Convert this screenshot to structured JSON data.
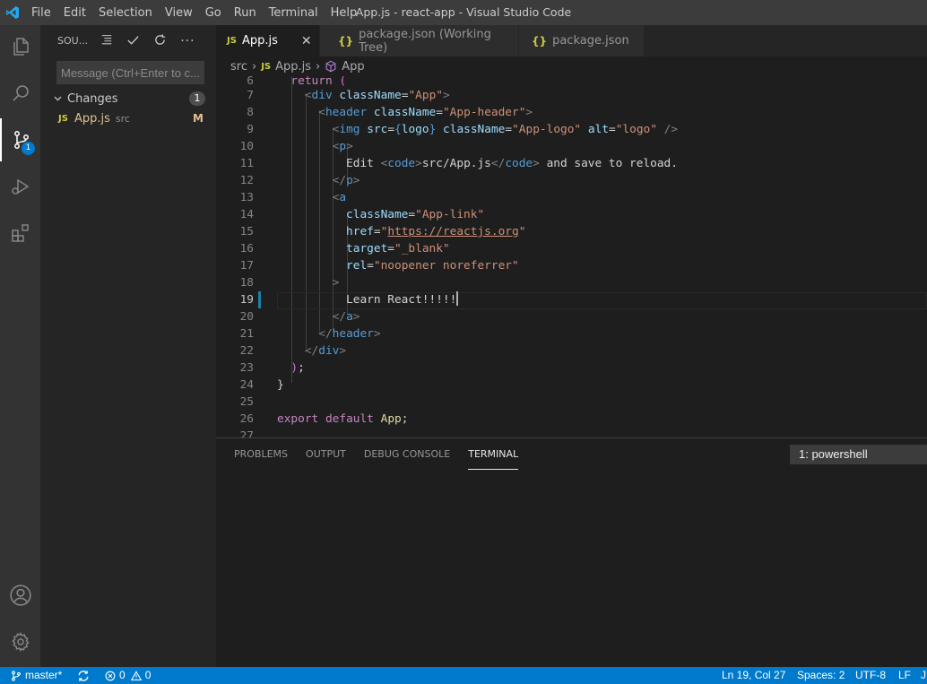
{
  "window": {
    "title": "App.js - react-app - Visual Studio Code"
  },
  "menu": [
    "File",
    "Edit",
    "Selection",
    "View",
    "Go",
    "Run",
    "Terminal",
    "Help"
  ],
  "activity": {
    "scm_badge": "1"
  },
  "sidebar": {
    "header": "SOU...",
    "message_placeholder": "Message (Ctrl+Enter to c...",
    "changes_label": "Changes",
    "changes_count": "1",
    "file": {
      "icon": "JS",
      "name": "App.js",
      "dir": "src",
      "status": "M"
    }
  },
  "tabs": [
    {
      "label": "App.js",
      "icon": "JS"
    },
    {
      "label": "package.json (Working Tree)",
      "icon": "{}"
    },
    {
      "label": "package.json",
      "icon": "{}"
    }
  ],
  "breadcrumb": {
    "folder": "src",
    "file_icon": "JS",
    "file": "App.js",
    "symbol": "App"
  },
  "editor": {
    "lines": [
      "6",
      "7",
      "8",
      "9",
      "10",
      "11",
      "12",
      "13",
      "14",
      "15",
      "16",
      "17",
      "18",
      "19",
      "20",
      "21",
      "22",
      "23",
      "24",
      "25",
      "26",
      "27"
    ]
  },
  "panel": {
    "tabs": [
      "PROBLEMS",
      "OUTPUT",
      "DEBUG CONSOLE",
      "TERMINAL"
    ],
    "terminal_select": "1: powershell"
  },
  "status": {
    "branch": "master*",
    "errors": "0",
    "warnings": "0",
    "position": "Ln 19, Col 27",
    "spaces": "Spaces: 2",
    "encoding": "UTF-8",
    "eol": "LF",
    "language": "J"
  },
  "colors": {
    "accent": "#007acc",
    "activity_bg": "#333333",
    "sidebar_bg": "#252526",
    "editor_bg": "#1e1e1e"
  }
}
